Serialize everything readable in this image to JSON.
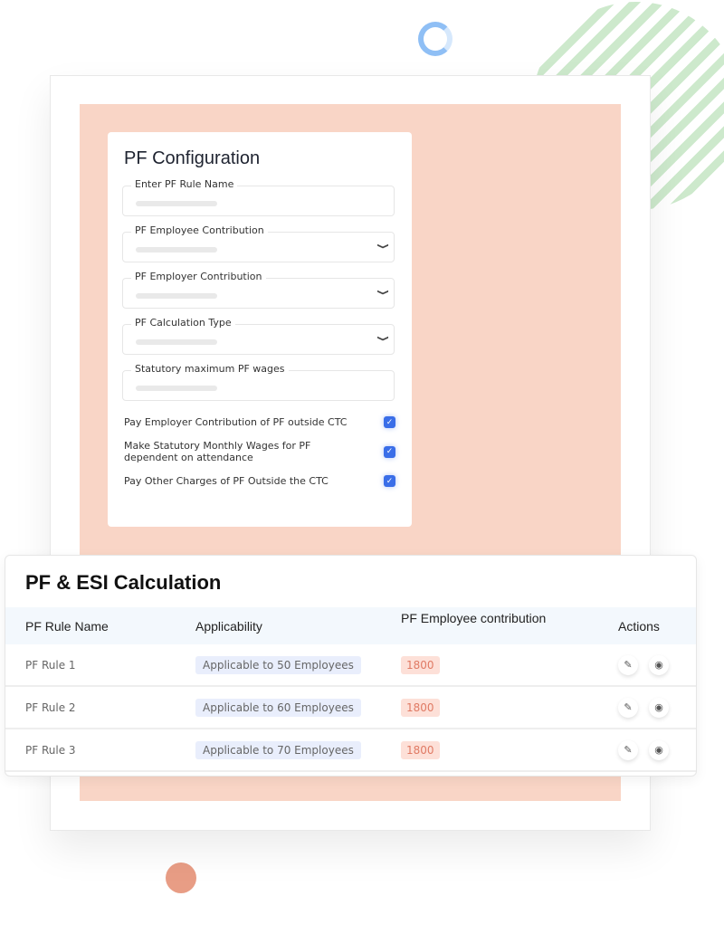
{
  "form": {
    "title": "PF Configuration",
    "fields": [
      {
        "label": "Enter PF Rule Name",
        "type": "text"
      },
      {
        "label": "PF Employee Contribution",
        "type": "select"
      },
      {
        "label": "PF Employer Contribution",
        "type": "select"
      },
      {
        "label": "PF Calculation Type",
        "type": "select"
      },
      {
        "label": "Statutory maximum PF wages",
        "type": "text"
      }
    ],
    "checks": [
      {
        "label": "Pay Employer Contribution of PF outside CTC",
        "checked": true
      },
      {
        "label": "Make Statutory Monthly Wages for PF dependent on attendance",
        "checked": true
      },
      {
        "label": "Pay Other Charges of PF Outside the CTC",
        "checked": true
      }
    ]
  },
  "table": {
    "title": "PF & ESI Calculation",
    "headers": [
      "PF Rule Name",
      "Applicability",
      "PF Employee contribution",
      "Actions"
    ],
    "rows": [
      {
        "name": "PF Rule 1",
        "applicability": "Applicable to 50 Employees",
        "contribution": "1800"
      },
      {
        "name": "PF Rule 2",
        "applicability": "Applicable to 60 Employees",
        "contribution": "1800"
      },
      {
        "name": "PF Rule 3",
        "applicability": "Applicable to 70 Employees",
        "contribution": "1800"
      }
    ]
  },
  "colors": {
    "background_panel": "#f9d5c6",
    "checkbox": "#3a6ee8",
    "badge": "#fde0d8",
    "pill": "#e9eefc"
  }
}
